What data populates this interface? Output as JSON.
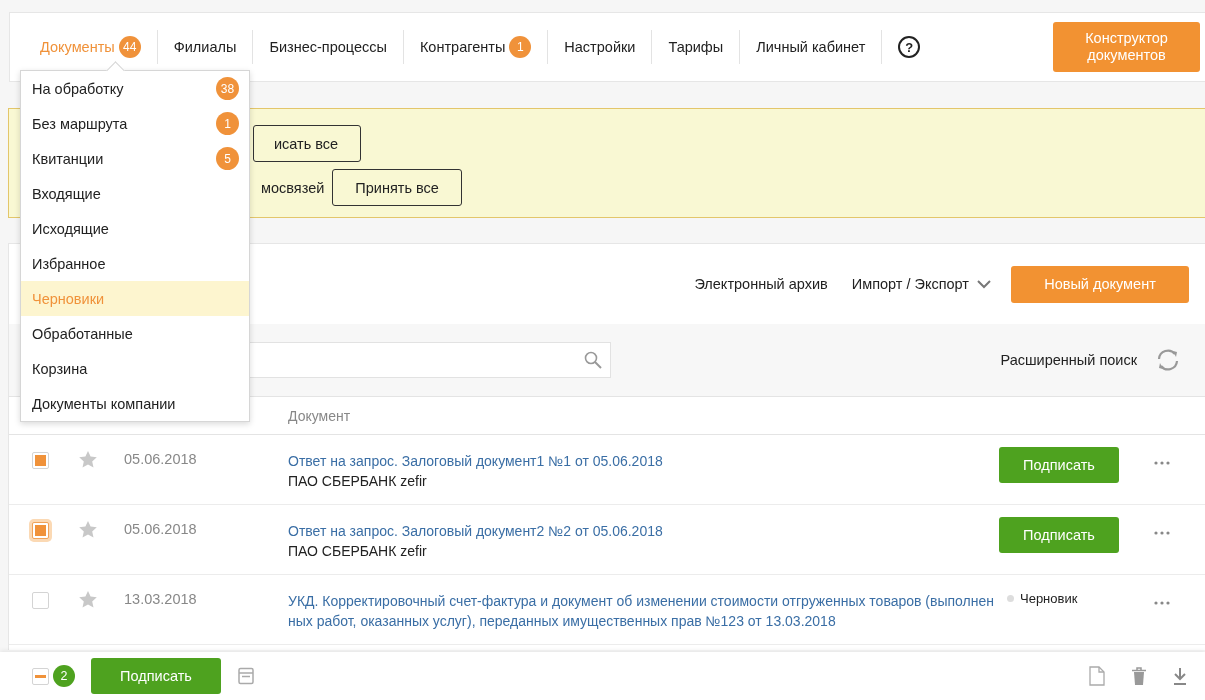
{
  "nav": {
    "tabs": [
      {
        "label": "Документы",
        "badge": "44",
        "selected": true
      },
      {
        "label": "Филиалы",
        "selected": false
      },
      {
        "label": "Бизнес-процессы",
        "selected": false
      },
      {
        "label": "Контрагенты",
        "badge": "1",
        "selected": false
      },
      {
        "label": "Настройки",
        "selected": false
      },
      {
        "label": "Тарифы",
        "selected": false
      },
      {
        "label": "Личный кабинет",
        "selected": false
      }
    ],
    "help_icon": "?",
    "constructor_button": "Конструктор документов"
  },
  "documents_menu": {
    "items": [
      {
        "label": "На обработку",
        "badge": "38",
        "selected": false
      },
      {
        "label": "Без маршрута",
        "badge": "1",
        "selected": false
      },
      {
        "label": "Квитанции",
        "badge": "5",
        "selected": false
      },
      {
        "label": "Входящие",
        "selected": false
      },
      {
        "label": "Исходящие",
        "selected": false
      },
      {
        "label": "Избранное",
        "selected": false
      },
      {
        "label": "Черновики",
        "selected": true
      },
      {
        "label": "Обработанные",
        "selected": false
      },
      {
        "label": "Корзина",
        "selected": false
      },
      {
        "label": "Документы компании",
        "selected": false
      }
    ]
  },
  "notice": {
    "sign_all_button": "исать все",
    "text": "мосвязей",
    "accept_all_button": "Принять все"
  },
  "toolbar": {
    "archive_link": "Электронный архив",
    "import_export_menu": "Импорт / Экспорт",
    "new_document_button": "Новый документ"
  },
  "search": {
    "advanced_search": "Расширенный поиск"
  },
  "table": {
    "columns": [
      "Документ"
    ],
    "rows": [
      {
        "checked": true,
        "focused": false,
        "date": "05.06.2018",
        "title": "Ответ на запрос. Залоговый документ1 №1 от 05.06.2018",
        "counterparty": "ПАО СБЕРБАНК zefir",
        "action": "Подписать"
      },
      {
        "checked": true,
        "focused": true,
        "date": "05.06.2018",
        "title": "Ответ на запрос. Залоговый документ2 №2 от 05.06.2018",
        "counterparty": "ПАО СБЕРБАНК zefir",
        "action": "Подписать"
      },
      {
        "checked": false,
        "focused": false,
        "date": "13.03.2018",
        "title": "УКД. Корректировочный счет-фактура и документ об изменении стоимости отгруженных товаров (выполненных работ, оказанных услуг), переданных имущественных прав №123 от 13.03.2018",
        "status": "Черновик"
      }
    ]
  },
  "footer": {
    "partially_checked": true,
    "selected_count": "2",
    "sign_button": "Подписать"
  }
}
